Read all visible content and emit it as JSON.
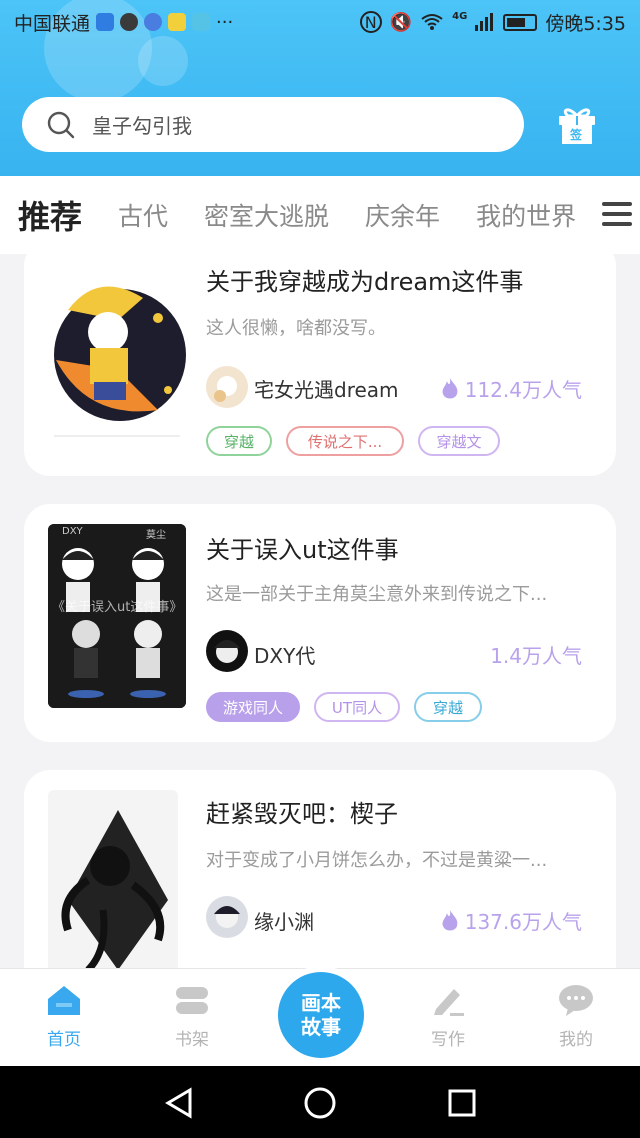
{
  "status_bar": {
    "carrier": "中国联通",
    "right_text": "傍晚5:35",
    "signal": "4G"
  },
  "search": {
    "placeholder": "皇子勾引我"
  },
  "gift_button": {
    "label": "签"
  },
  "tabs": [
    {
      "label": "推荐",
      "active": true
    },
    {
      "label": "古代"
    },
    {
      "label": "密室大逃脱"
    },
    {
      "label": "庆余年"
    },
    {
      "label": "我的世界"
    }
  ],
  "cards": [
    {
      "title": "关于我穿越成为dream这件事",
      "desc": "这人很懒，啥都没写。",
      "author": "宅女光遇dream",
      "popularity": "112.4万人气",
      "tags": [
        "穿越",
        "传说之下...",
        "穿越文"
      ]
    },
    {
      "title": "关于误入ut这件事",
      "desc": "这是一部关于主角莫尘意外来到传说之下...",
      "author": "DXY代",
      "popularity": "1.4万人气",
      "tags": [
        "游戏同人",
        "UT同人",
        "穿越"
      ],
      "cover_text": "《关于误入ut这件事》",
      "cover_labels": [
        "DXY",
        "莫尘"
      ]
    },
    {
      "title": "赶紧毁灭吧：楔子",
      "desc": "对于变成了小月饼怎么办，不过是黄粱一...",
      "author": "缘小渊",
      "popularity": "137.6万人气"
    }
  ],
  "bottom_nav": {
    "home": "首页",
    "shelf": "书架",
    "center_line1": "画本",
    "center_line2": "故事",
    "write": "写作",
    "mine": "我的"
  },
  "colors": {
    "header": "#3db8f3",
    "accent": "#9f82e8",
    "nav_active": "#3aa8ee"
  }
}
